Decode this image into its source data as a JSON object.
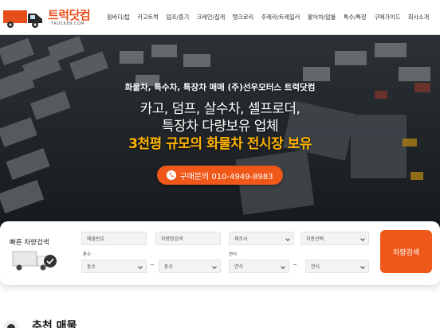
{
  "header": {
    "logo_text": "트럭닷컴",
    "logo_sub": "TRUCK89.COM",
    "nav": [
      "윙바디/탑",
      "카고트럭",
      "덤프/중기",
      "크레인/집게",
      "탱크로리",
      "추레라/트레일러",
      "활어차/암롤",
      "특수/특장",
      "구매가이드",
      "회사소개"
    ]
  },
  "hero": {
    "line1": "화물차, 특수차, 특장차 매매 (주)선우모터스 트럭닷컴",
    "line2": "카고, 덤프, 살수차, 셀프로더,",
    "line3": "특장차 다량보유 업체",
    "line4": "3천평 규모의 화물차 전시장 보유",
    "phone_label": "구매문의 010-4949-8983"
  },
  "search": {
    "title": "빠른 차량검색",
    "fields": {
      "listing_no": "매물번호",
      "vehicle_name": "차량명검색",
      "maker": "제조사",
      "model": "차종선택",
      "tonnage_label": "톤수",
      "ton_from": "톤수",
      "ton_to": "톤수",
      "year_label": "연식",
      "year_from": "연식",
      "year_to": "연식",
      "tilde": "~"
    },
    "button_label": "차량검색"
  },
  "recommended": {
    "title": "추천 매물"
  },
  "colors": {
    "accent": "#f0581a",
    "highlight": "#ffb300"
  }
}
